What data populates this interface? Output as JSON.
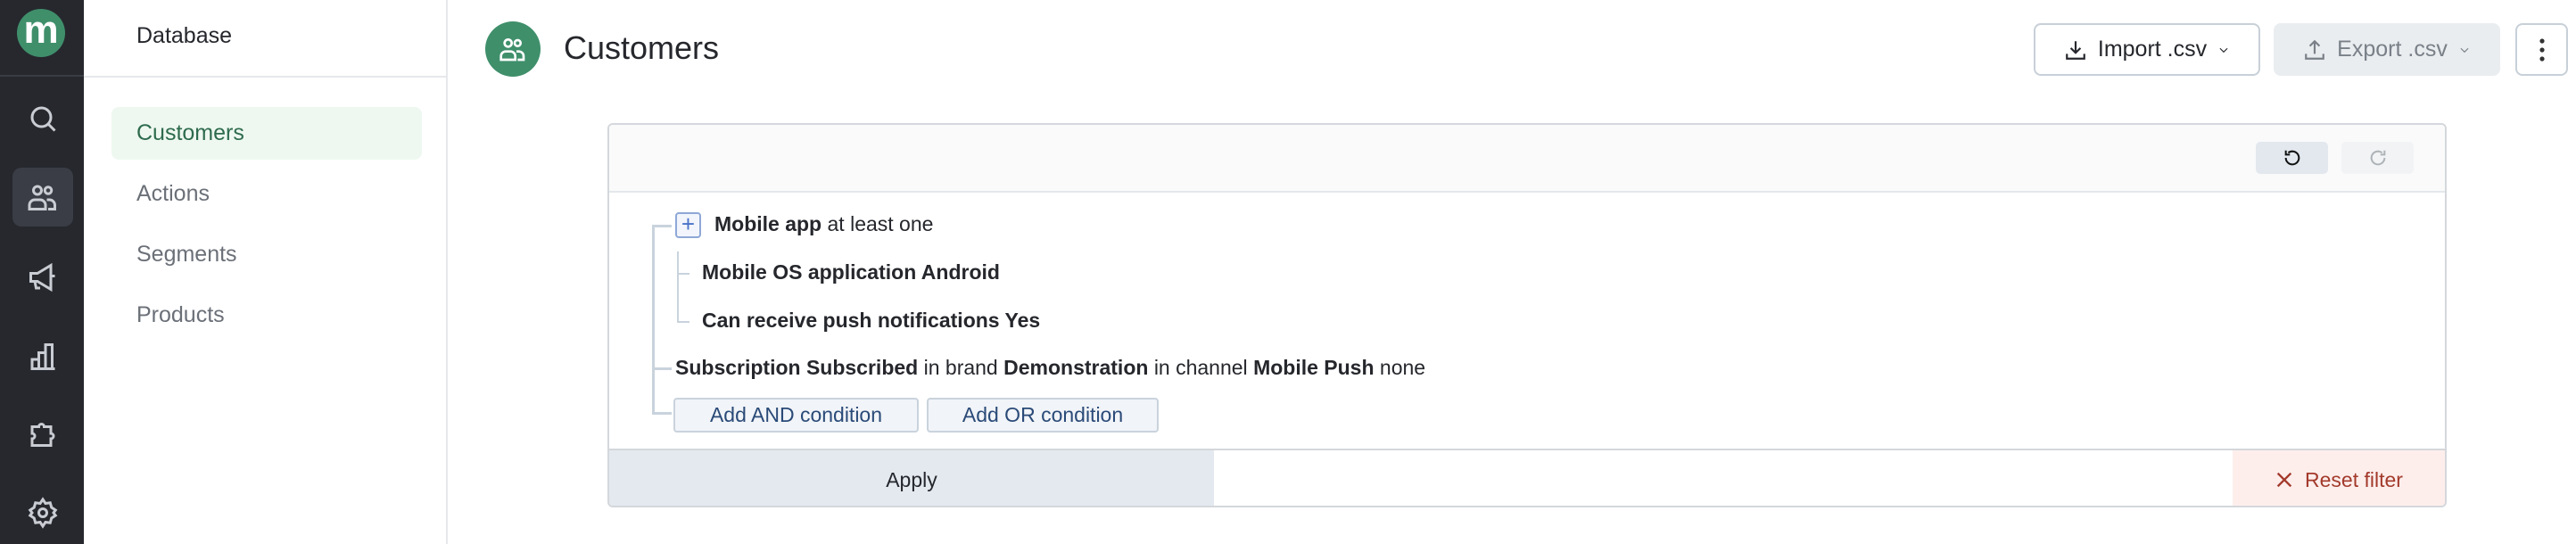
{
  "brand": {
    "logo_letter": "m",
    "accent": "#3f8f6b"
  },
  "rail": {
    "items": [
      {
        "icon": "search-icon"
      },
      {
        "icon": "users-icon",
        "active": true
      },
      {
        "icon": "megaphone-icon"
      },
      {
        "icon": "bar-chart-icon"
      },
      {
        "icon": "puzzle-icon"
      },
      {
        "icon": "gear-icon"
      }
    ]
  },
  "sidebar": {
    "title": "Database",
    "items": [
      {
        "label": "Customers",
        "active": true
      },
      {
        "label": "Actions"
      },
      {
        "label": "Segments"
      },
      {
        "label": "Products"
      }
    ]
  },
  "header": {
    "title": "Customers",
    "import_label": "Import .csv",
    "export_label": "Export .csv"
  },
  "filter": {
    "group": {
      "bold": "Mobile app",
      "rest": "at least one"
    },
    "children": [
      {
        "bold": "Mobile OS application Android"
      },
      {
        "bold": "Can receive push notifications Yes"
      }
    ],
    "subscription": {
      "p1": "Subscription Subscribed",
      "p2": "in brand",
      "p3": "Demonstration",
      "p4": "in channel",
      "p5": "Mobile Push",
      "p6": "none"
    },
    "add_and": "Add AND condition",
    "add_or": "Add OR condition",
    "apply": "Apply",
    "reset": "Reset filter"
  }
}
